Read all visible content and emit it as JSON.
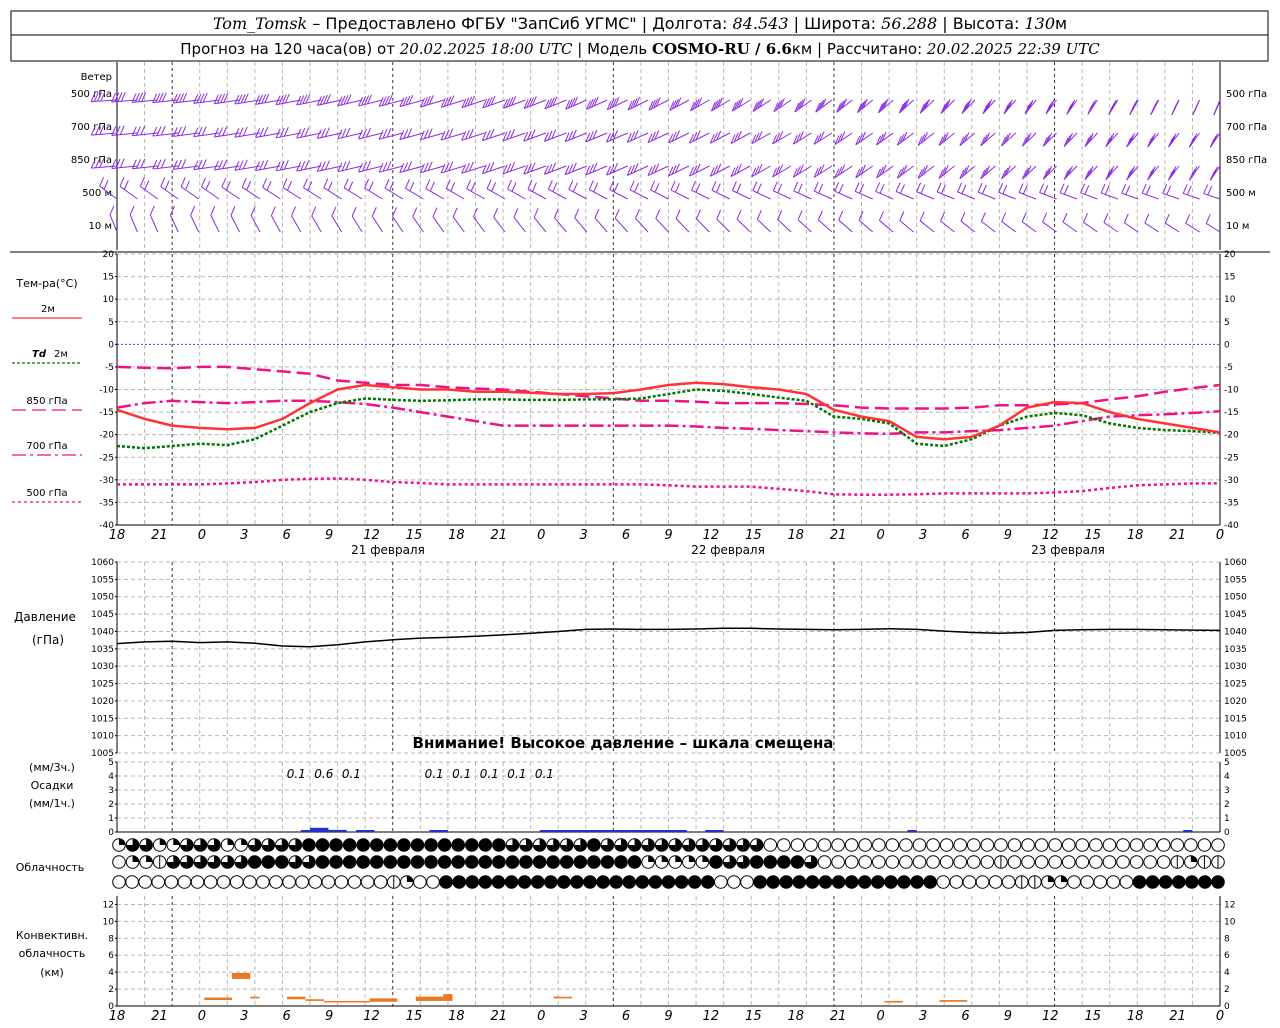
{
  "header": {
    "station": "Tom_Tomsk",
    "line1_rest": " – Предоставлено ФГБУ \"ЗапСиб УГМС\" | Долгота: ",
    "lon": "84.543",
    "lat_label": " | Широта: ",
    "lat": "56.288",
    "alt_label": " | Высота: ",
    "alt": "130",
    "alt_unit": "м",
    "line2_a": "Прогноз на 120 часа(ов) от ",
    "run": "20.02.2025 18:00 UTC",
    "model_label": " | Модель ",
    "model": "COSMO-RU / 6.6",
    "model_unit": "км",
    "calc_label": " | Рассчитано: ",
    "calc": "20.02.2025 22:39 UTC"
  },
  "wind_panel": {
    "title": "Ветер",
    "levels": [
      "500 гПа",
      "700 гПа",
      "850 гПа",
      "500 м",
      "10  м"
    ],
    "barb_color": "#8a2be2"
  },
  "time_axis": {
    "hour_labels": [
      "18",
      "21",
      "0",
      "3",
      "6",
      "9",
      "12",
      "15",
      "18",
      "21",
      "0",
      "3",
      "6",
      "9",
      "12",
      "15",
      "18",
      "21",
      "0",
      "3",
      "6",
      "9",
      "12",
      "15",
      "18",
      "21",
      "0"
    ],
    "days": [
      "21 февраля",
      "22 февраля",
      "23 февраля"
    ]
  },
  "chart_data": [
    {
      "type": "line",
      "title": "Тем-ра(°С)",
      "ylim": [
        -40,
        20
      ],
      "yticks": [
        20,
        15,
        10,
        5,
        0,
        -5,
        -10,
        -15,
        -20,
        -25,
        -30,
        -35,
        -40
      ],
      "x_hours": [
        0,
        3,
        6,
        9,
        12,
        15,
        18,
        21,
        24,
        27,
        30,
        33,
        36,
        39,
        42,
        45,
        48,
        51,
        54,
        57,
        60,
        63,
        66,
        69,
        72,
        75,
        78,
        81,
        84,
        87,
        90,
        93,
        96,
        99,
        102,
        105,
        108,
        111,
        114,
        117,
        120
      ],
      "series": [
        {
          "name": "2м",
          "color": "#ff3333",
          "dash": "",
          "width": 2.5,
          "values": [
            -14.5,
            -16.5,
            -18,
            -18.5,
            -18.8,
            -18.5,
            -16.5,
            -13,
            -10,
            -9,
            -9.5,
            -10,
            -10,
            -10.5,
            -10.5,
            -10.7,
            -11,
            -11,
            -10.8,
            -10,
            -9,
            -8.5,
            -8.8,
            -9.5,
            -10,
            -11,
            -14.5,
            -16,
            -17,
            -20.5,
            -21,
            -20.5,
            -18,
            -14,
            -12.8,
            -13,
            -15,
            -16.5,
            -17.5,
            -18.5,
            -19.5
          ]
        },
        {
          "name": "Td 2м",
          "color": "#007700",
          "dash": "3,2",
          "width": 2.5,
          "values": [
            -22.5,
            -23,
            -22.5,
            -22,
            -22.3,
            -21,
            -18,
            -15,
            -13,
            -12,
            -12.3,
            -12.5,
            -12.4,
            -12.2,
            -12.2,
            -12.3,
            -12.3,
            -12.2,
            -12.2,
            -12,
            -11,
            -10,
            -10.3,
            -11,
            -11.8,
            -12.5,
            -16,
            -16.5,
            -17.5,
            -22,
            -22.5,
            -21,
            -18,
            -16,
            -15.2,
            -15.7,
            -17.5,
            -18.5,
            -19,
            -19.2,
            -19.6
          ]
        },
        {
          "name": "850 гПа",
          "color": "#ee1188",
          "dash": "14,6",
          "width": 2.5,
          "values": [
            -5,
            -5.2,
            -5.3,
            -5,
            -5,
            -5.5,
            -6,
            -6.5,
            -8,
            -8.5,
            -9,
            -9,
            -9.5,
            -9.8,
            -10,
            -10.5,
            -11,
            -11.5,
            -12,
            -12.5,
            -12.5,
            -12.7,
            -13,
            -13,
            -13,
            -13.2,
            -13.5,
            -14,
            -14.2,
            -14.2,
            -14.2,
            -14,
            -13.5,
            -13.5,
            -13.3,
            -13,
            -12.2,
            -11.5,
            -10.5,
            -9.7,
            -9
          ]
        },
        {
          "name": "700 гПа",
          "color": "#ee1188",
          "dash": "14,4,3,4",
          "width": 2.5,
          "values": [
            -14,
            -13,
            -12.5,
            -12.8,
            -13,
            -12.8,
            -12.5,
            -12.5,
            -12.8,
            -13.2,
            -14,
            -15,
            -16,
            -17,
            -18,
            -18,
            -18,
            -18,
            -18,
            -18,
            -18,
            -18.2,
            -18.5,
            -18.7,
            -19,
            -19.2,
            -19.5,
            -19.7,
            -19.8,
            -19.5,
            -19.5,
            -19.2,
            -19,
            -18.5,
            -18,
            -17,
            -16,
            -15.7,
            -15.5,
            -15.2,
            -14.8
          ]
        },
        {
          "name": "500 гПа",
          "color": "#ee1188",
          "dash": "3,3",
          "width": 2.5,
          "values": [
            -31,
            -31,
            -31,
            -31,
            -30.8,
            -30.5,
            -30,
            -29.8,
            -29.7,
            -30,
            -30.5,
            -30.7,
            -31,
            -31,
            -31,
            -31,
            -31,
            -31,
            -31,
            -31,
            -31.2,
            -31.5,
            -31.5,
            -31.5,
            -32,
            -32.5,
            -33.2,
            -33.3,
            -33.3,
            -33.2,
            -33,
            -33,
            -33,
            -33,
            -32.8,
            -32.5,
            -31.8,
            -31.2,
            -31,
            -30.8,
            -30.8
          ]
        }
      ]
    },
    {
      "type": "line",
      "title": "Давление",
      "ylabel": "(гПа)",
      "ylim": [
        1005,
        1060
      ],
      "yticks": [
        1060,
        1055,
        1050,
        1045,
        1040,
        1035,
        1030,
        1025,
        1020,
        1015,
        1010,
        1005
      ],
      "x_hours": [
        0,
        3,
        6,
        9,
        12,
        15,
        18,
        21,
        24,
        27,
        30,
        33,
        36,
        39,
        42,
        45,
        48,
        51,
        54,
        57,
        60,
        63,
        66,
        69,
        72,
        75,
        78,
        81,
        84,
        87,
        90,
        93,
        96,
        99,
        102,
        105,
        108,
        111,
        114,
        117,
        120
      ],
      "series": [
        {
          "name": "Давление",
          "color": "#000000",
          "values": [
            1036.5,
            1037,
            1037.2,
            1036.8,
            1037,
            1036.6,
            1035.8,
            1035.6,
            1036.2,
            1037,
            1037.6,
            1038.1,
            1038.3,
            1038.6,
            1039,
            1039.5,
            1040,
            1040.6,
            1040.7,
            1040.6,
            1040.6,
            1040.7,
            1040.9,
            1040.9,
            1040.7,
            1040.6,
            1040.5,
            1040.6,
            1040.8,
            1040.6,
            1040.1,
            1039.7,
            1039.5,
            1039.7,
            1040.3,
            1040.5,
            1040.6,
            1040.6,
            1040.5,
            1040.4,
            1040.3
          ]
        }
      ],
      "annotation": "Внимание! Высокое давление – шкала смещена"
    },
    {
      "type": "bar",
      "title": "Осадки",
      "ylabels": [
        "(мм/3ч.)",
        "(мм/1ч.)"
      ],
      "ylim": [
        0,
        5
      ],
      "yticks": [
        5,
        4,
        3,
        2,
        1,
        0
      ],
      "bars": [
        {
          "start": 20,
          "end": 21,
          "value": 0.1
        },
        {
          "start": 21,
          "end": 23,
          "value": 0.3
        },
        {
          "start": 23,
          "end": 25,
          "value": 0.15
        },
        {
          "start": 26,
          "end": 28,
          "value": 0.05
        },
        {
          "start": 34,
          "end": 36,
          "value": 0.05
        },
        {
          "start": 46,
          "end": 52,
          "value": 0.08
        },
        {
          "start": 52,
          "end": 56,
          "value": 0.1
        },
        {
          "start": 56,
          "end": 62,
          "value": 0.06
        },
        {
          "start": 64,
          "end": 66,
          "value": 0.04
        },
        {
          "start": 86,
          "end": 87,
          "value": 0.03
        },
        {
          "start": 116,
          "end": 117,
          "value": 0.03
        }
      ],
      "sum_labels": [
        {
          "hour": 19.5,
          "text": "0.1"
        },
        {
          "hour": 22.5,
          "text": "0.6"
        },
        {
          "hour": 25.5,
          "text": "0.1"
        },
        {
          "hour": 34.5,
          "text": "0.1"
        },
        {
          "hour": 37.5,
          "text": "0.1"
        },
        {
          "hour": 40.5,
          "text": "0.1"
        },
        {
          "hour": 43.5,
          "text": "0.1"
        },
        {
          "hour": 46.5,
          "text": "0.1"
        }
      ]
    },
    {
      "type": "table",
      "title": "Облачность",
      "rows": [
        [
          2,
          3,
          3,
          2,
          2,
          3,
          3,
          3,
          2,
          2,
          3,
          3,
          3,
          3,
          4,
          4,
          4,
          4,
          4,
          4,
          4,
          4,
          4,
          4,
          4,
          4,
          4,
          4,
          4,
          3,
          3,
          3,
          3,
          3,
          3,
          4,
          3,
          3,
          3,
          3,
          3,
          3,
          3,
          3,
          3,
          3,
          3,
          3,
          0,
          0,
          0,
          0,
          0,
          0,
          0,
          0,
          0,
          0,
          0,
          0,
          0,
          0,
          0,
          0,
          0,
          0,
          0,
          0,
          0,
          0,
          0,
          0,
          0,
          0,
          0,
          0,
          0,
          0,
          0,
          0,
          0,
          0
        ],
        [
          0,
          2,
          2,
          1,
          3,
          3,
          3,
          3,
          3,
          3,
          4,
          4,
          4,
          3,
          3,
          4,
          4,
          4,
          4,
          4,
          4,
          4,
          4,
          4,
          4,
          4,
          4,
          4,
          4,
          4,
          4,
          4,
          4,
          4,
          4,
          4,
          4,
          4,
          4,
          2,
          2,
          2,
          2,
          2,
          4,
          3,
          3,
          4,
          4,
          4,
          4,
          3,
          0,
          0,
          0,
          0,
          0,
          0,
          0,
          0,
          0,
          0,
          0,
          0,
          0,
          1,
          0,
          0,
          0,
          0,
          0,
          0,
          0,
          0,
          0,
          0,
          0,
          0,
          1,
          2,
          1,
          1
        ],
        [
          0,
          0,
          0,
          0,
          0,
          0,
          0,
          0,
          0,
          0,
          0,
          0,
          0,
          0,
          0,
          0,
          0,
          0,
          0,
          0,
          0,
          1,
          2,
          0,
          0,
          4,
          4,
          4,
          4,
          4,
          4,
          4,
          4,
          4,
          4,
          4,
          4,
          4,
          4,
          4,
          4,
          4,
          4,
          4,
          4,
          4,
          0,
          0,
          0,
          4,
          4,
          4,
          4,
          4,
          4,
          4,
          4,
          4,
          4,
          4,
          4,
          4,
          4,
          0,
          0,
          0,
          0,
          0,
          0,
          1,
          1,
          2,
          2,
          0,
          0,
          0,
          0,
          0,
          4,
          4,
          4,
          4,
          4,
          4,
          4
        ]
      ]
    },
    {
      "type": "bar",
      "title": "Конвективн. облачность",
      "ylabel": "(км)",
      "ylim": [
        0,
        13
      ],
      "yticks": [
        12,
        10,
        8,
        6,
        4,
        2,
        0
      ],
      "segments": [
        {
          "start": 9.5,
          "end": 12.5,
          "bottom": 0.7,
          "top": 1.0
        },
        {
          "start": 12.5,
          "end": 14.5,
          "bottom": 3.2,
          "top": 3.9
        },
        {
          "start": 14.5,
          "end": 15.5,
          "bottom": 0.9,
          "top": 1.1
        },
        {
          "start": 18.5,
          "end": 20.5,
          "bottom": 0.8,
          "top": 1.1
        },
        {
          "start": 20.5,
          "end": 22.5,
          "bottom": 0.6,
          "top": 0.8
        },
        {
          "start": 22.5,
          "end": 27.5,
          "bottom": 0.5,
          "top": 0.6
        },
        {
          "start": 27.5,
          "end": 30.5,
          "bottom": 0.5,
          "top": 0.9
        },
        {
          "start": 32.5,
          "end": 35.5,
          "bottom": 0.6,
          "top": 1.1
        },
        {
          "start": 35.5,
          "end": 36.5,
          "bottom": 0.6,
          "top": 1.4
        },
        {
          "start": 47.5,
          "end": 49.5,
          "bottom": 0.9,
          "top": 1.1
        },
        {
          "start": 83.5,
          "end": 85.5,
          "bottom": 0.4,
          "top": 0.6
        },
        {
          "start": 89.5,
          "end": 92.5,
          "bottom": 0.5,
          "top": 0.7
        }
      ]
    }
  ]
}
